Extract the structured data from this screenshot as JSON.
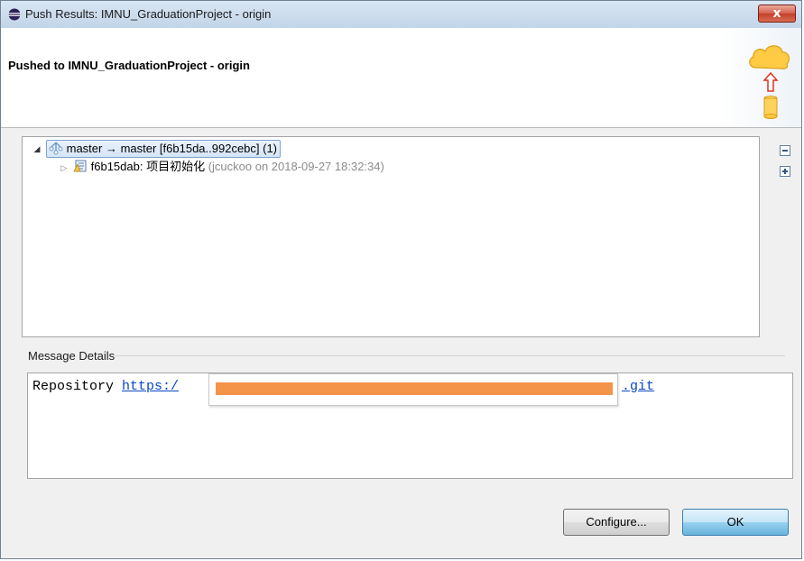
{
  "window": {
    "title": "Push Results: IMNU_GraduationProject - origin",
    "close_label": "x"
  },
  "header": {
    "title": "Pushed to IMNU_GraduationProject - origin"
  },
  "tree": {
    "ref_update": "master → master [f6b15da..992cebc] (1)",
    "commit_label": "f6b15dab: 项目初始化",
    "commit_meta": "(jcuckoo on 2018-09-27 18:32:34)"
  },
  "message": {
    "section_label": "Message Details",
    "prefix": "Repository",
    "link_start": "https:/",
    "link_end": ".git"
  },
  "buttons": {
    "configure": "Configure...",
    "ok": "OK"
  },
  "colors": {
    "redaction": "#f4934a",
    "link": "#0a47c6"
  }
}
